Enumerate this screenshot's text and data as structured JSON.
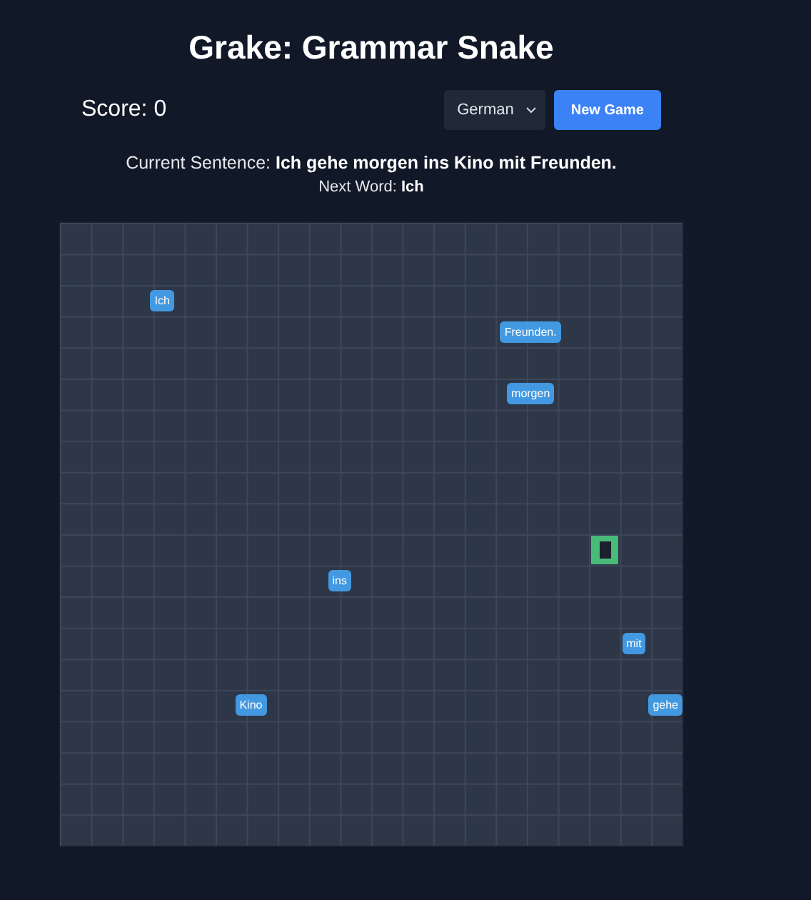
{
  "title": "Grake: Grammar Snake",
  "score": "Score: 0",
  "language_select": {
    "value": "German"
  },
  "new_game_button": "New Game",
  "current_sentence": {
    "label": "Current Sentence:",
    "value": "Ich gehe morgen ins Kino mit Freunden."
  },
  "next_word": {
    "label": "Next Word:",
    "value": "Ich"
  },
  "board": {
    "items": [
      {
        "kind": "word",
        "text": "Ich"
      },
      {
        "kind": "word",
        "text": "Freunden."
      },
      {
        "kind": "word",
        "text": "morgen"
      },
      {
        "kind": "snake"
      },
      {
        "kind": "word",
        "text": "ins"
      },
      {
        "kind": "word",
        "text": "mit"
      },
      {
        "kind": "word",
        "text": "Kino"
      },
      {
        "kind": "word",
        "text": "gehe"
      }
    ]
  }
}
